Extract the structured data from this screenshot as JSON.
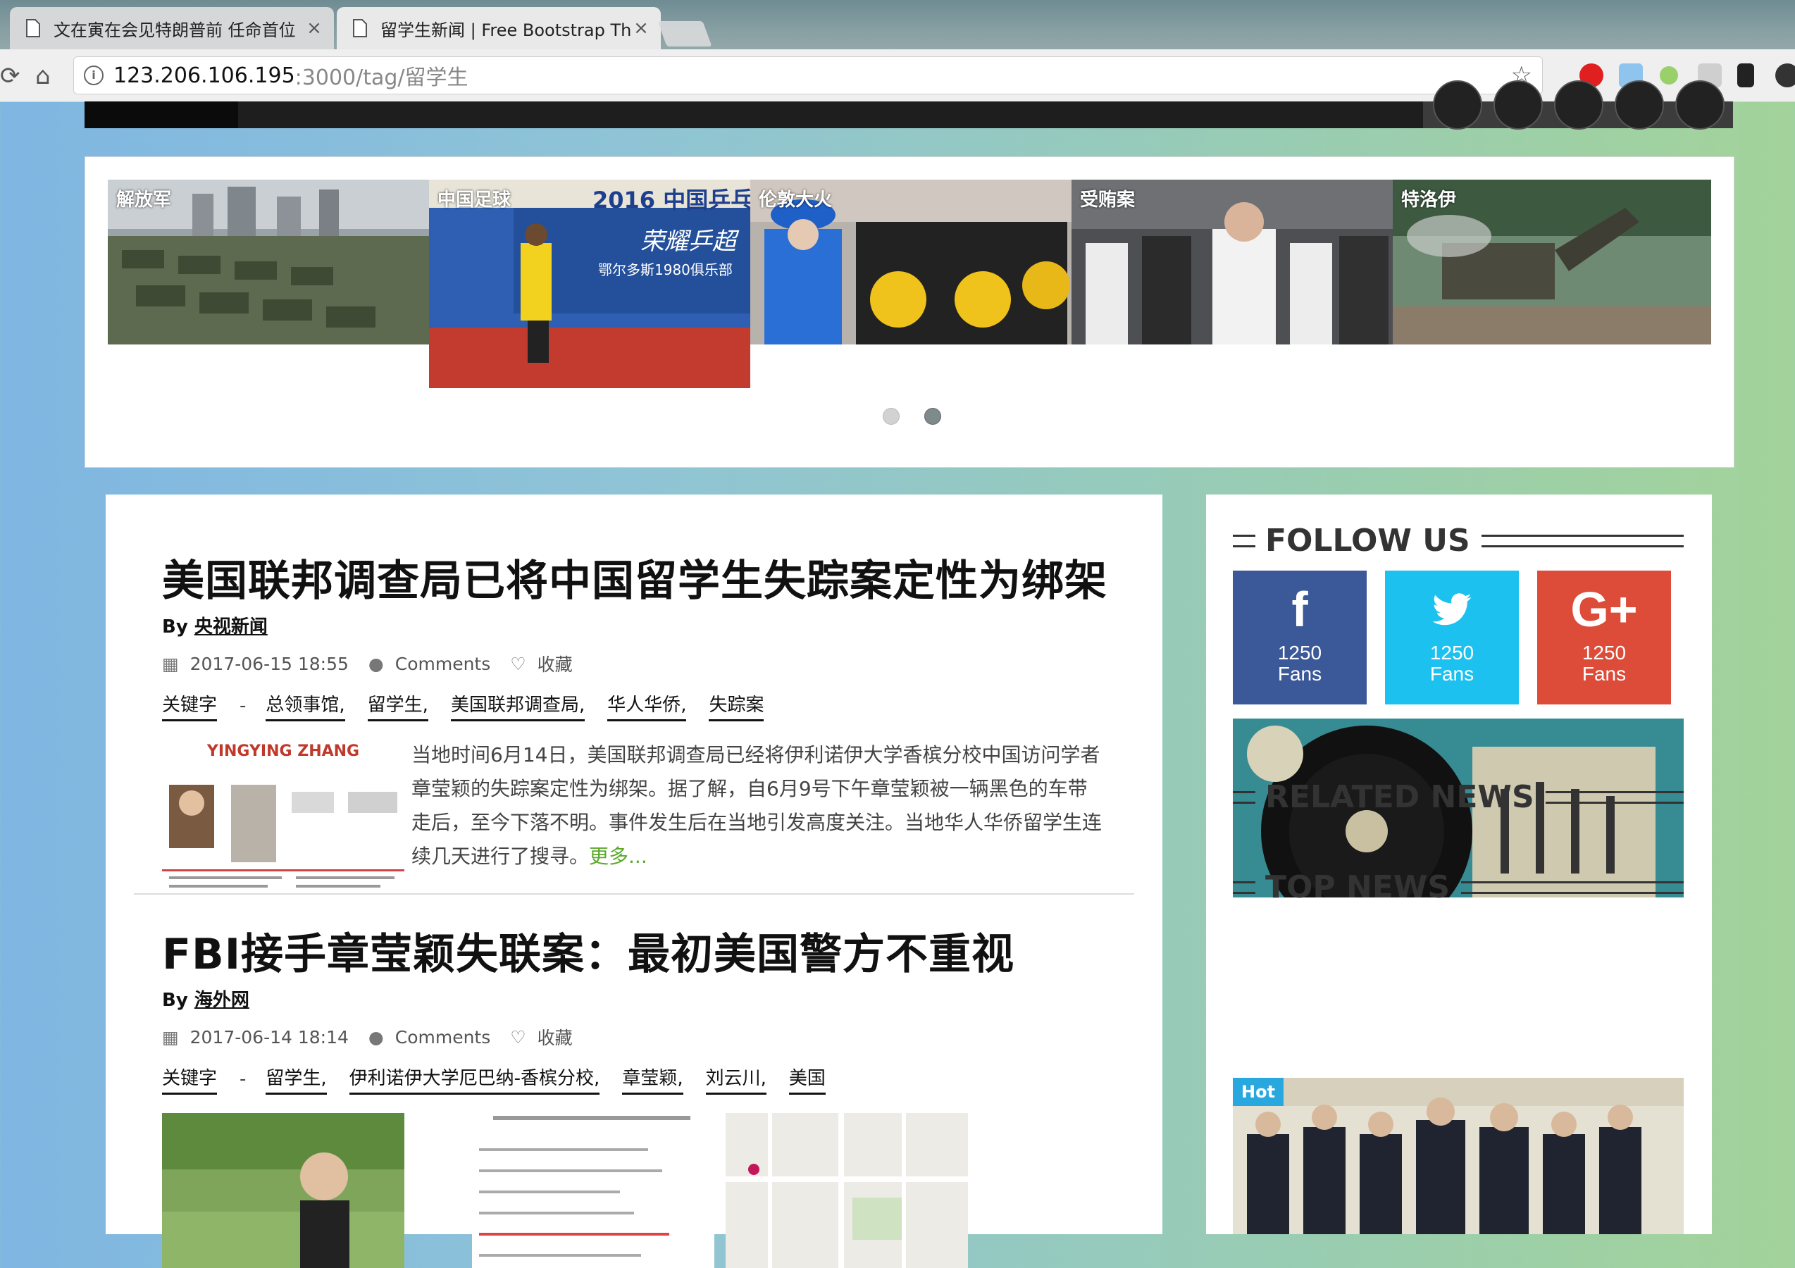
{
  "browser": {
    "tabs": [
      {
        "title": "文在寅在会见特朗普前 任命首位"
      },
      {
        "title": "留学生新闻 | Free Bootstrap Th"
      }
    ],
    "tab_close_glyph": "×",
    "url_host": "123.206.106.195",
    "url_path": ":3000/tag/留学生"
  },
  "slider": {
    "slides": [
      {
        "label": "解放军"
      },
      {
        "label": "中国足球"
      },
      {
        "label": "伦敦大火"
      },
      {
        "label": "受贿案"
      },
      {
        "label": "特洛伊"
      }
    ],
    "slide2_banner": "2016 中国乒乓",
    "slide2_sub": "荣耀乒超",
    "slide2_club": "鄂尔多斯1980俱乐部",
    "dots": 2,
    "active_dot": 1
  },
  "articles": [
    {
      "title": "美国联邦调查局已将中国留学生失踪案定性为绑架",
      "by_label": "By",
      "author": "央视新闻",
      "date": "2017-06-15 18:55",
      "comments": "Comments",
      "favorite": "收藏",
      "tags_label": "关键字",
      "tags": [
        "总领事馆,",
        "留学生,",
        "美国联邦调查局,",
        "华人华侨,",
        "失踪案"
      ],
      "thumb_caption": "YINGYING ZHANG",
      "excerpt": "当地时间6月14日，美国联邦调查局已经将伊利诺伊大学香槟分校中国访问学者章莹颖的失踪案定性为绑架。据了解，自6月9号下午章莹颖被一辆黑色的车带走后，至今下落不明。事件发生后在当地引发高度关注。当地华人华侨留学生连续几天进行了搜寻。",
      "more": "更多..."
    },
    {
      "title": "FBI接手章莹颖失联案：最初美国警方不重视",
      "by_label": "By",
      "author": "海外网",
      "date": "2017-06-14 18:14",
      "comments": "Comments",
      "favorite": "收藏",
      "tags_label": "关键字",
      "tags": [
        "留学生,",
        "伊利诺伊大学厄巴纳-香槟分校,",
        "章莹颖,",
        "刘云川,",
        "美国"
      ]
    }
  ],
  "sidebar": {
    "follow_title": "FOLLOW US",
    "fans": [
      {
        "network": "facebook",
        "icon": "f",
        "count": "1250",
        "label": "Fans",
        "color": "#3b5998"
      },
      {
        "network": "twitter",
        "icon": "twitter-bird",
        "count": "1250",
        "label": "Fans",
        "color": "#1dc1f0"
      },
      {
        "network": "google-plus",
        "icon": "G+",
        "count": "1250",
        "label": "Fans",
        "color": "#dd4b39"
      }
    ],
    "related_title": "RELATED NEWS",
    "top_title": "TOP NEWS",
    "hot_badge": "Hot"
  },
  "colors": {
    "accent_green": "#5aa82a",
    "hot_blue": "#29a8e0"
  }
}
